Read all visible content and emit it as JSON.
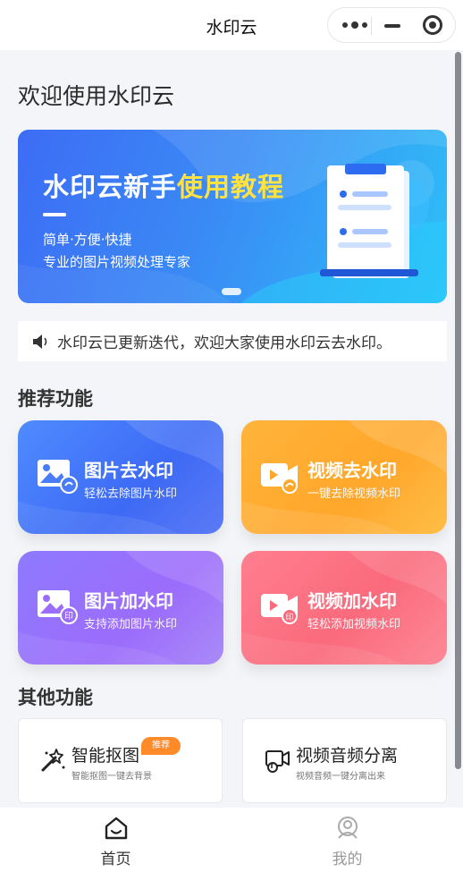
{
  "nav": {
    "title": "水印云"
  },
  "welcome": "欢迎使用水印云",
  "banner": {
    "title_main": "水印云新手",
    "title_highlight": "使用教程",
    "subtitle1": "简单·方便·快捷",
    "subtitle2": "专业的图片视频处理专家",
    "highlight_color": "#ffe23f"
  },
  "notice": {
    "icon": "speaker-icon",
    "text": "水印云已更新迭代，欢迎大家使用水印云去水印。"
  },
  "recommend": {
    "title": "推荐功能",
    "cards": [
      {
        "title": "图片去水印",
        "subtitle": "轻松去除图片水印",
        "icon": "image-remove-icon",
        "color": "#3d6af5"
      },
      {
        "title": "视频去水印",
        "subtitle": "一键去除视频水印",
        "icon": "video-remove-icon",
        "color": "#ffa72a"
      },
      {
        "title": "图片加水印",
        "subtitle": "支持添加图片水印",
        "icon": "image-add-watermark-icon",
        "color": "#9c6cfb"
      },
      {
        "title": "视频加水印",
        "subtitle": "轻松添加视频水印",
        "icon": "video-add-watermark-icon",
        "color": "#fa6a7c"
      }
    ]
  },
  "other": {
    "title": "其他功能",
    "cards": [
      {
        "title": "智能抠图",
        "subtitle": "智能抠图一键去背景",
        "tag": "推荐",
        "icon": "magic-wand-icon"
      },
      {
        "title": "视频音频分离",
        "subtitle": "视频音频一键分离出来",
        "icon": "video-audio-icon"
      }
    ]
  },
  "tabbar": {
    "items": [
      {
        "label": "首页",
        "icon": "home-icon",
        "active": true
      },
      {
        "label": "我的",
        "icon": "profile-icon",
        "active": false
      }
    ]
  }
}
